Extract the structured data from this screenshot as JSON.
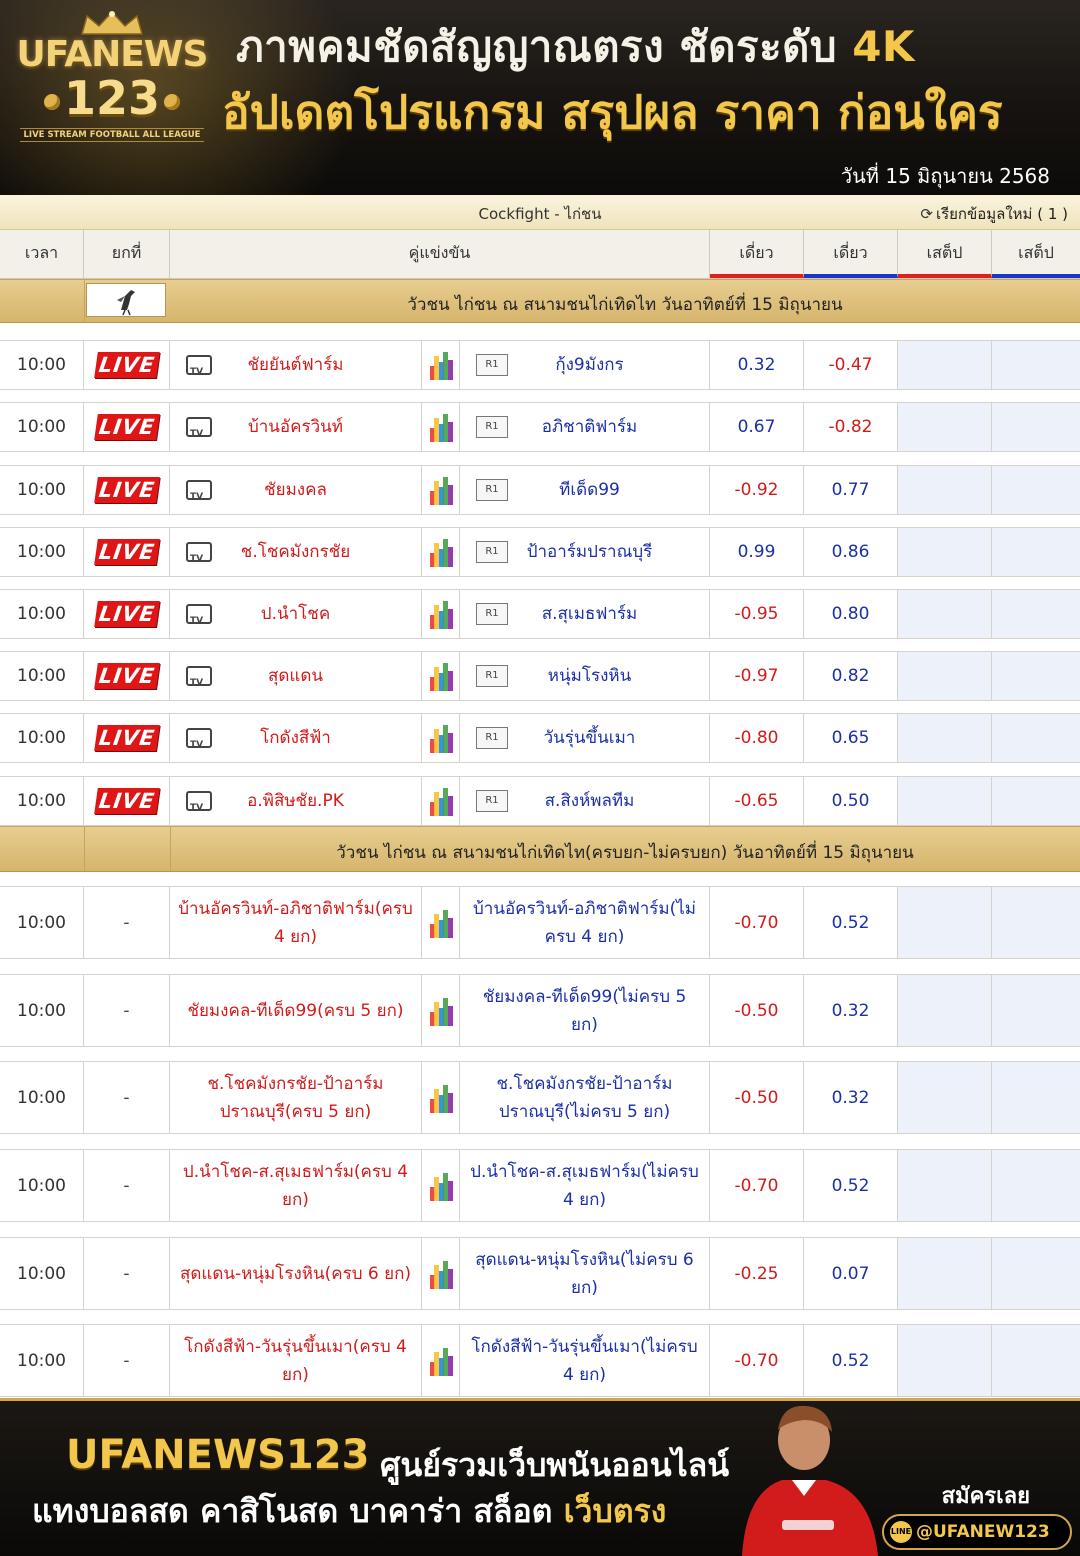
{
  "header": {
    "logo_brand": "UFANEWS",
    "logo_number": "123",
    "logo_tagline": "LIVE STREAM FOOTBALL ALL LEAGUE",
    "headline_line1": "ภาพคมชัดสัญญาณตรง ชัดระดับ",
    "headline_4k": "4K",
    "headline_line2": "อัปเดตโปรแกรม สรุปผล ราคา ก่อนใคร",
    "date": "วันที่ 15 มิถุนายน 2568"
  },
  "titlebar": {
    "sport": "Cockfight - ไก่ชน",
    "refresh_label": "เรียกข้อมูลใหม่ ( 1 )"
  },
  "columns": {
    "time": "เวลา",
    "round": "ยกที่",
    "match": "คู่แข่งขัน",
    "odds1": "เดี่ยว",
    "odds2": "เดี่ยว",
    "set1": "เสต็ป",
    "set2": "เสต็ป"
  },
  "sections": [
    {
      "label": "วัวชน ไก่ชน ณ สนามชนไก่เทิดไท วันอาทิตย์ที่ 15 มิถุนายน"
    },
    {
      "label": "วัวชน ไก่ชน ณ สนามชนไก่เทิดไท(ครบยก-ไม่ครบยก) วันอาทิตย์ที่ 15 มิถุนายน"
    }
  ],
  "live_label": "LIVE",
  "round_label": "R1",
  "matches": [
    {
      "time": "10:00",
      "home": "ชัยยันต์ฟาร์ม",
      "away": "กุ้ง9มังกร",
      "odds1": "0.32",
      "odds2": "-0.47"
    },
    {
      "time": "10:00",
      "home": "บ้านอัครวินท์",
      "away": "อภิชาติฟาร์ม",
      "odds1": "0.67",
      "odds2": "-0.82"
    },
    {
      "time": "10:00",
      "home": "ชัยมงคล",
      "away": "ทีเด็ด99",
      "odds1": "-0.92",
      "odds2": "0.77"
    },
    {
      "time": "10:00",
      "home": "ช.โชคมังกรชัย",
      "away": "ป้าอาร์มปราณบุรี",
      "odds1": "0.99",
      "odds2": "0.86"
    },
    {
      "time": "10:00",
      "home": "ป.นำโชค",
      "away": "ส.สุเมธฟาร์ม",
      "odds1": "-0.95",
      "odds2": "0.80"
    },
    {
      "time": "10:00",
      "home": "สุดแดน",
      "away": "หนุ่มโรงหิน",
      "odds1": "-0.97",
      "odds2": "0.82"
    },
    {
      "time": "10:00",
      "home": "โกดังสีฟ้า",
      "away": "วันรุ่นขึ้นเมา",
      "odds1": "-0.80",
      "odds2": "0.65"
    },
    {
      "time": "10:00",
      "home": "อ.พิสิษชัย.PK",
      "away": "ส.สิงห์พลทีม",
      "odds1": "-0.65",
      "odds2": "0.50"
    }
  ],
  "specials": [
    {
      "time": "10:00",
      "round": "-",
      "home": "บ้านอัครวินท์-อภิชาติฟาร์ม(ครบ 4 ยก)",
      "away": "บ้านอัครวินท์-อภิชาติฟาร์ม(ไม่ครบ 4 ยก)",
      "odds1": "-0.70",
      "odds2": "0.52"
    },
    {
      "time": "10:00",
      "round": "-",
      "home": "ชัยมงคล-ทีเด็ด99(ครบ 5 ยก)",
      "away": "ชัยมงคล-ทีเด็ด99(ไม่ครบ 5 ยก)",
      "odds1": "-0.50",
      "odds2": "0.32"
    },
    {
      "time": "10:00",
      "round": "-",
      "home": "ช.โชคมังกรชัย-ป้าอาร์มปราณบุรี(ครบ 5 ยก)",
      "away": "ช.โชคมังกรชัย-ป้าอาร์มปราณบุรี(ไม่ครบ 5 ยก)",
      "odds1": "-0.50",
      "odds2": "0.32"
    },
    {
      "time": "10:00",
      "round": "-",
      "home": "ป.นำโชค-ส.สุเมธฟาร์ม(ครบ 4 ยก)",
      "away": "ป.นำโชค-ส.สุเมธฟาร์ม(ไม่ครบ 4 ยก)",
      "odds1": "-0.70",
      "odds2": "0.52"
    },
    {
      "time": "10:00",
      "round": "-",
      "home": "สุดแดน-หนุ่มโรงหิน(ครบ 6 ยก)",
      "away": "สุดแดน-หนุ่มโรงหิน(ไม่ครบ 6 ยก)",
      "odds1": "-0.25",
      "odds2": "0.07"
    },
    {
      "time": "10:00",
      "round": "-",
      "home": "โกดังสีฟ้า-วันรุ่นขึ้นเมา(ครบ 4 ยก)",
      "away": "โกดังสีฟ้า-วันรุ่นขึ้นเมา(ไม่ครบ 4 ยก)",
      "odds1": "-0.70",
      "odds2": "0.52"
    }
  ],
  "footer": {
    "brand": "UFANEWS123",
    "tagline1": "ศูนย์รวมเว็บพนันออนไลน์",
    "tagline2": "แทงบอลสด คาสิโนสด บาคาร่า สล็อต",
    "tagline2_gold": "เว็บตรง",
    "signup": "สมัครเลย",
    "line_icon": "LINE",
    "line_id": "@UFANEW123"
  },
  "colors": {
    "positive": "#1a2fa8",
    "negative": "#d11a1a",
    "live": "#e01515",
    "gold": "#f2c74b"
  }
}
